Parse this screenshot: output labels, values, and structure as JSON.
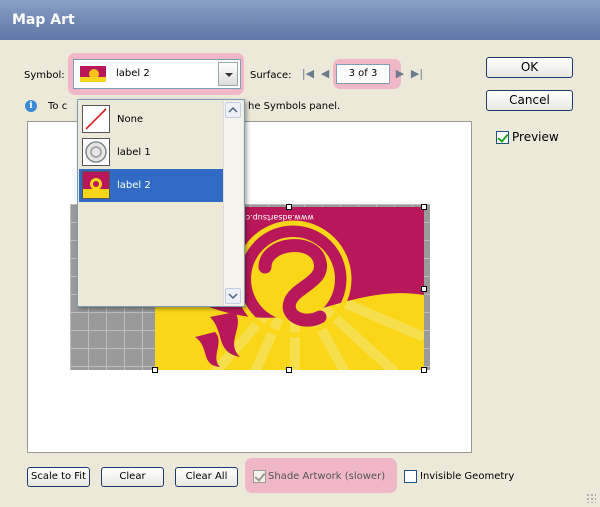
{
  "window": {
    "title": "Map Art"
  },
  "symbol": {
    "label": "Symbol:",
    "selected": "label 2"
  },
  "surface": {
    "label": "Surface:",
    "value": "3 of 3"
  },
  "info_text_left": "To c",
  "info_text_right": "he Symbols panel.",
  "symbol_list": {
    "items": [
      {
        "label": "None",
        "icon": "none-swatch-icon",
        "selected": false
      },
      {
        "label": "label 1",
        "icon": "label-1-swatch-icon",
        "selected": false
      },
      {
        "label": "label 2",
        "icon": "label-2-swatch-icon",
        "selected": true
      }
    ]
  },
  "buttons": {
    "ok": "OK",
    "cancel": "Cancel",
    "scale_to_fit": "Scale to Fit",
    "clear": "Clear",
    "clear_all": "Clear All"
  },
  "checkboxes": {
    "preview": {
      "label": "Preview",
      "checked": true
    },
    "shade_artwork": {
      "label": "Shade Artwork (slower)",
      "checked": true,
      "enabled": false
    },
    "invisible_geometry": {
      "label": "Invisible Geometry",
      "checked": false
    }
  },
  "artwork": {
    "mirrored_text": "www.adsartsup.com"
  },
  "colors": {
    "highlight": "#f0b8c6",
    "selection": "#316ac5",
    "title_bar": "#7088b6",
    "art_magenta": "#b8175a",
    "art_yellow": "#f9d718"
  }
}
